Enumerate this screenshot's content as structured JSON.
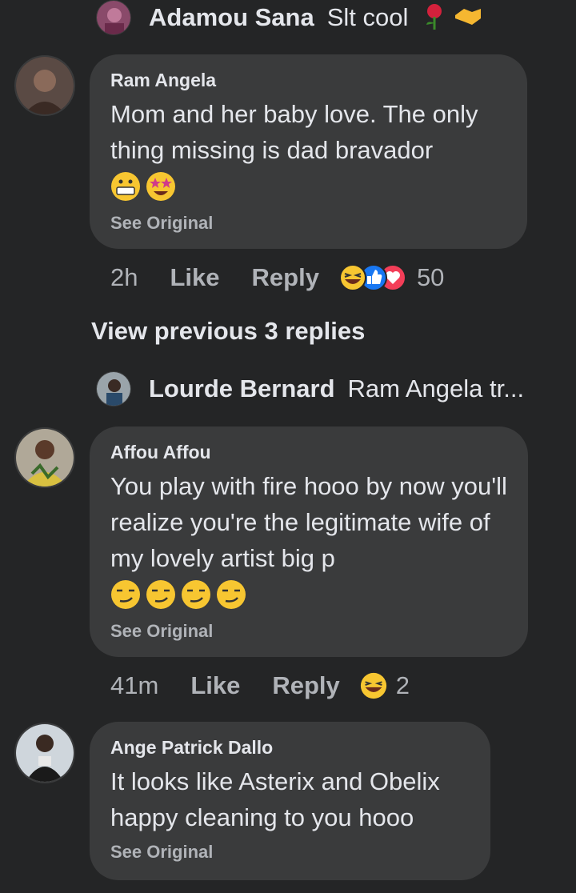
{
  "colors": {
    "background": "#242526",
    "bubble": "#3a3b3c",
    "text": "#e4e6eb",
    "muted": "#b0b3b8"
  },
  "collapsed_reply_top": {
    "name": "Adamou Sana",
    "text": "Slt cool",
    "emojis": [
      "rose-icon",
      "handshake-icon"
    ]
  },
  "comment1": {
    "author": "Ram Angela",
    "text": "Mom and her baby love. The only thing missing is dad bravador",
    "see_original": "See Original",
    "time": "2h",
    "like": "Like",
    "reply": "Reply",
    "reaction_count": "50",
    "reactions": [
      "haha-icon",
      "like-icon",
      "love-icon"
    ]
  },
  "view_previous": "View previous 3 replies",
  "collapsed_reply_mid": {
    "name": "Lourde Bernard",
    "text": "Ram Angela tr..."
  },
  "comment2": {
    "author": "Affou Affou",
    "text": "You play with fire hooo by now you'll realize you're the legitimate wife of my lovely artist big p",
    "see_original": "See Original",
    "time": "41m",
    "like": "Like",
    "reply": "Reply",
    "reaction_count": "2",
    "reactions": [
      "haha-icon"
    ]
  },
  "comment3": {
    "author": "Ange Patrick Dallo",
    "text": "It looks like Asterix and Obelix happy cleaning to you hooo",
    "see_original": "See Original"
  }
}
